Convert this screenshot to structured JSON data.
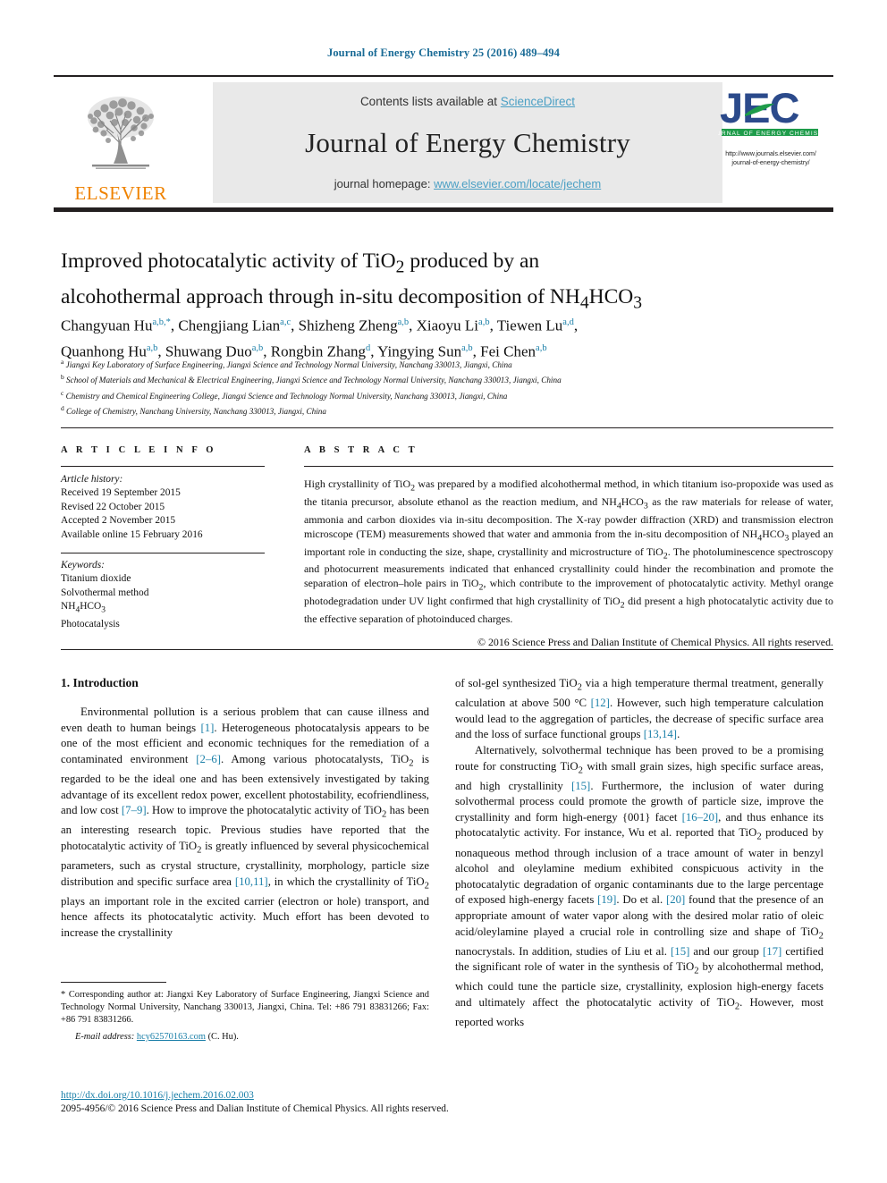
{
  "running_head": "Journal of Energy Chemistry 25 (2016) 489–494",
  "masthead": {
    "contents_prefix": "Contents lists available at ",
    "sciencedirect": "ScienceDirect",
    "journal_title": "Journal of Energy Chemistry",
    "homepage_prefix": "journal homepage: ",
    "homepage_url": "www.elsevier.com/locate/jechem",
    "elsevier_wordmark": "ELSEVIER",
    "jec_wordmark": "JEC",
    "jec_subtitle": "JOURNAL OF ENERGY CHEMISTRY",
    "jec_url_line1": "http://www.journals.elsevier.com/",
    "jec_url_line2": "journal-of-energy-chemistry/",
    "colors": {
      "band_bg": "#e9e9e9",
      "link_blue": "#4a9fc4",
      "elsevier_orange": "#ef8200",
      "jec_blue": "#2b4a8b",
      "jec_green": "#1e9c4a",
      "running_head_blue": "#1a6b96"
    }
  },
  "article": {
    "title_line1": "Improved photocatalytic activity of TiO2 produced by an",
    "title_line2": "alcohothermal approach through in-situ decomposition of NH4HCO3",
    "authors_line1": "Changyuan Hu a,b,*, Chengjiang Lian a,c, Shizheng Zheng a,b, Xiaoyu Li a,b, Tiewen Lu a,d,",
    "authors_line2": "Quanhong Hu a,b, Shuwang Duo a,b, Rongbin Zhang d, Yingying Sun a,b, Fei Chen a,b",
    "affiliations": [
      "a Jiangxi Key Laboratory of Surface Engineering, Jiangxi Science and Technology Normal University, Nanchang 330013, Jiangxi, China",
      "b School of Materials and Mechanical & Electrical Engineering, Jiangxi Science and Technology Normal University, Nanchang 330013, Jiangxi, China",
      "c Chemistry and Chemical Engineering College, Jiangxi Science and Technology Normal University, Nanchang 330013, Jiangxi, China",
      "d College of Chemistry, Nanchang University, Nanchang 330013, Jiangxi, China"
    ]
  },
  "article_info": {
    "heading": "A R T I C L E   I N F O",
    "history_label": "Article history:",
    "history": [
      "Received 19 September 2015",
      "Revised 22 October 2015",
      "Accepted 2 November 2015",
      "Available online 15 February 2016"
    ],
    "keywords_label": "Keywords:",
    "keywords": [
      "Titanium dioxide",
      "Solvothermal method",
      "NH4HCO3",
      "Photocatalysis"
    ]
  },
  "abstract": {
    "heading": "A B S T R A C T",
    "text": "High crystallinity of TiO2 was prepared by a modified alcohothermal method, in which titanium iso-propoxide was used as the titania precursor, absolute ethanol as the reaction medium, and NH4HCO3 as the raw materials for release of water, ammonia and carbon dioxides via in-situ decomposition. The X-ray powder diffraction (XRD) and transmission electron microscope (TEM) measurements showed that water and ammonia from the in-situ decomposition of NH4HCO3 played an important role in conducting the size, shape, crystallinity and microstructure of TiO2. The photoluminescence spectroscopy and photocurrent measurements indicated that enhanced crystallinity could hinder the recombination and promote the separation of electron–hole pairs in TiO2, which contribute to the improvement of photocatalytic activity. Methyl orange photodegradation under UV light confirmed that high crystallinity of TiO2 did present a high photocatalytic activity due to the effective separation of photoinduced charges.",
    "copyright": "© 2016 Science Press and Dalian Institute of Chemical Physics. All rights reserved."
  },
  "introduction": {
    "section_title": "1. Introduction",
    "left_paragraph_1": "Environmental pollution is a serious problem that can cause illness and even death to human beings [1]. Heterogeneous photocatalysis appears to be one of the most efficient and economic techniques for the remediation of a contaminated environment [2–6]. Among various photocatalysts, TiO2 is regarded to be the ideal one and has been extensively investigated by taking advantage of its excellent redox power, excellent photostability, ecofriendliness, and low cost [7–9]. How to improve the photocatalytic activity of TiO2 has been an interesting research topic. Previous studies have reported that the photocatalytic activity of TiO2 is greatly influenced by several physicochemical parameters, such as crystal structure, crystallinity, morphology, particle size distribution and specific surface area [10,11], in which the crystallinity of TiO2 plays an important role in the excited carrier (electron or hole) transport, and hence affects its photocatalytic activity. Much effort has been devoted to increase the crystallinity",
    "right_paragraph_1": "of sol-gel synthesized TiO2 via a high temperature thermal treatment, generally calculation at above 500 °C [12]. However, such high temperature calculation would lead to the aggregation of particles, the decrease of specific surface area and the loss of surface functional groups [13,14].",
    "right_paragraph_2": "Alternatively, solvothermal technique has been proved to be a promising route for constructing TiO2 with small grain sizes, high specific surface areas, and high crystallinity [15]. Furthermore, the inclusion of water during solvothermal process could promote the growth of particle size, improve the crystallinity and form high-energy {001} facet [16–20], and thus enhance its photocatalytic activity. For instance, Wu et al. reported that TiO2 produced by nonaqueous method through inclusion of a trace amount of water in benzyl alcohol and oleylamine medium exhibited conspicuous activity in the photocatalytic degradation of organic contaminants due to the large percentage of exposed high-energy facets [19]. Do et al. [20] found that the presence of an appropriate amount of water vapor along with the desired molar ratio of oleic acid/oleylamine played a crucial role in controlling size and shape of TiO2 nanocrystals. In addition, studies of Liu et al. [15] and our group [17] certified the significant role of water in the synthesis of TiO2 by alcohothermal method, which could tune the particle size, crystallinity, explosion high-energy facets and ultimately affect the photocatalytic activity of TiO2. However, most reported works"
  },
  "footnote": {
    "corresponding": "* Corresponding author at: Jiangxi Key Laboratory of Surface Engineering, Jiangxi Science and Technology Normal University, Nanchang 330013, Jiangxi, China. Tel: +86 791 83831266; Fax: +86 791 83831266.",
    "email_label": "E-mail address:",
    "email": "hcy62570163.com",
    "email_suffix": "(C. Hu)."
  },
  "footer": {
    "doi": "http://dx.doi.org/10.1016/j.jechem.2016.02.003",
    "issn_line": "2095-4956/© 2016 Science Press and Dalian Institute of Chemical Physics. All rights reserved."
  }
}
